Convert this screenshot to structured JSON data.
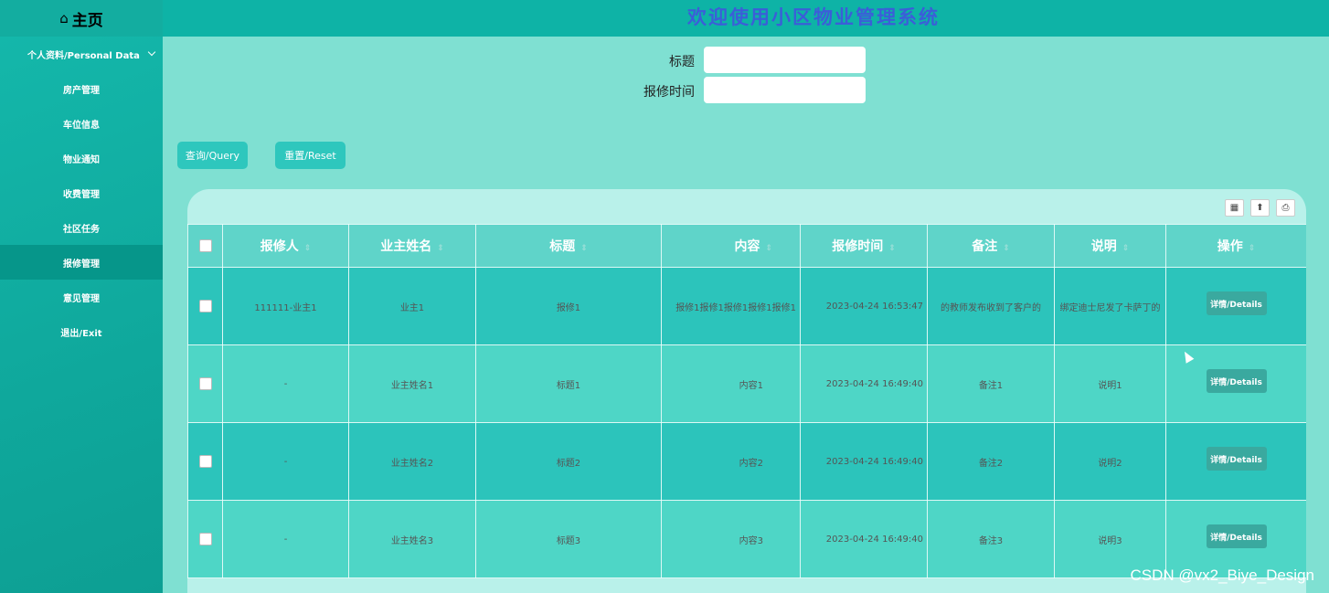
{
  "header": {
    "brand_icon": "home-icon",
    "brand_label": "主页",
    "site_title": "欢迎使用小区物业管理系统"
  },
  "sidebar": {
    "items": [
      {
        "label": "个人资料/Personal Data"
      },
      {
        "label": "房产管理"
      },
      {
        "label": "车位信息"
      },
      {
        "label": "物业通知"
      },
      {
        "label": "收费管理"
      },
      {
        "label": "社区任务"
      },
      {
        "label": "报修管理"
      },
      {
        "label": "意见管理"
      },
      {
        "label": "退出/Exit"
      }
    ]
  },
  "search": {
    "title_label": "标题",
    "title_value": "",
    "time_label": "报修时间",
    "time_value": "",
    "query_button": "查询/Query",
    "reset_button": "重置/Reset"
  },
  "table": {
    "columns": [
      "报修人",
      "业主姓名",
      "标题",
      "内容",
      "报修时间",
      "备注",
      "说明",
      "操作"
    ],
    "detail_label": "详情/Details",
    "rows": [
      {
        "c0": "111111-业主1",
        "c1": "业主1",
        "c2": "报修1",
        "c3": "报修1报修1报修1报修1报修1",
        "c4": "2023-04-24 16:53:47",
        "c5": "的教师发布收到了客户的",
        "c6": "绑定迪士尼发了卡萨丁的"
      },
      {
        "c0": "-",
        "c1": "业主姓名1",
        "c2": "标题1",
        "c3": "内容1",
        "c4": "2023-04-24 16:49:40",
        "c5": "备注1",
        "c6": "说明1"
      },
      {
        "c0": "-",
        "c1": "业主姓名2",
        "c2": "标题2",
        "c3": "内容2",
        "c4": "2023-04-24 16:49:40",
        "c5": "备注2",
        "c6": "说明2"
      },
      {
        "c0": "-",
        "c1": "业主姓名3",
        "c2": "标题3",
        "c3": "内容3",
        "c4": "2023-04-24 16:49:40",
        "c5": "备注3",
        "c6": "说明3"
      }
    ]
  },
  "watermark": "CSDN @vx2_Biye_Design",
  "colors": {
    "accent": "#2ec7bd",
    "sidebar": "#0fa89c",
    "active_item": "#06968a"
  }
}
